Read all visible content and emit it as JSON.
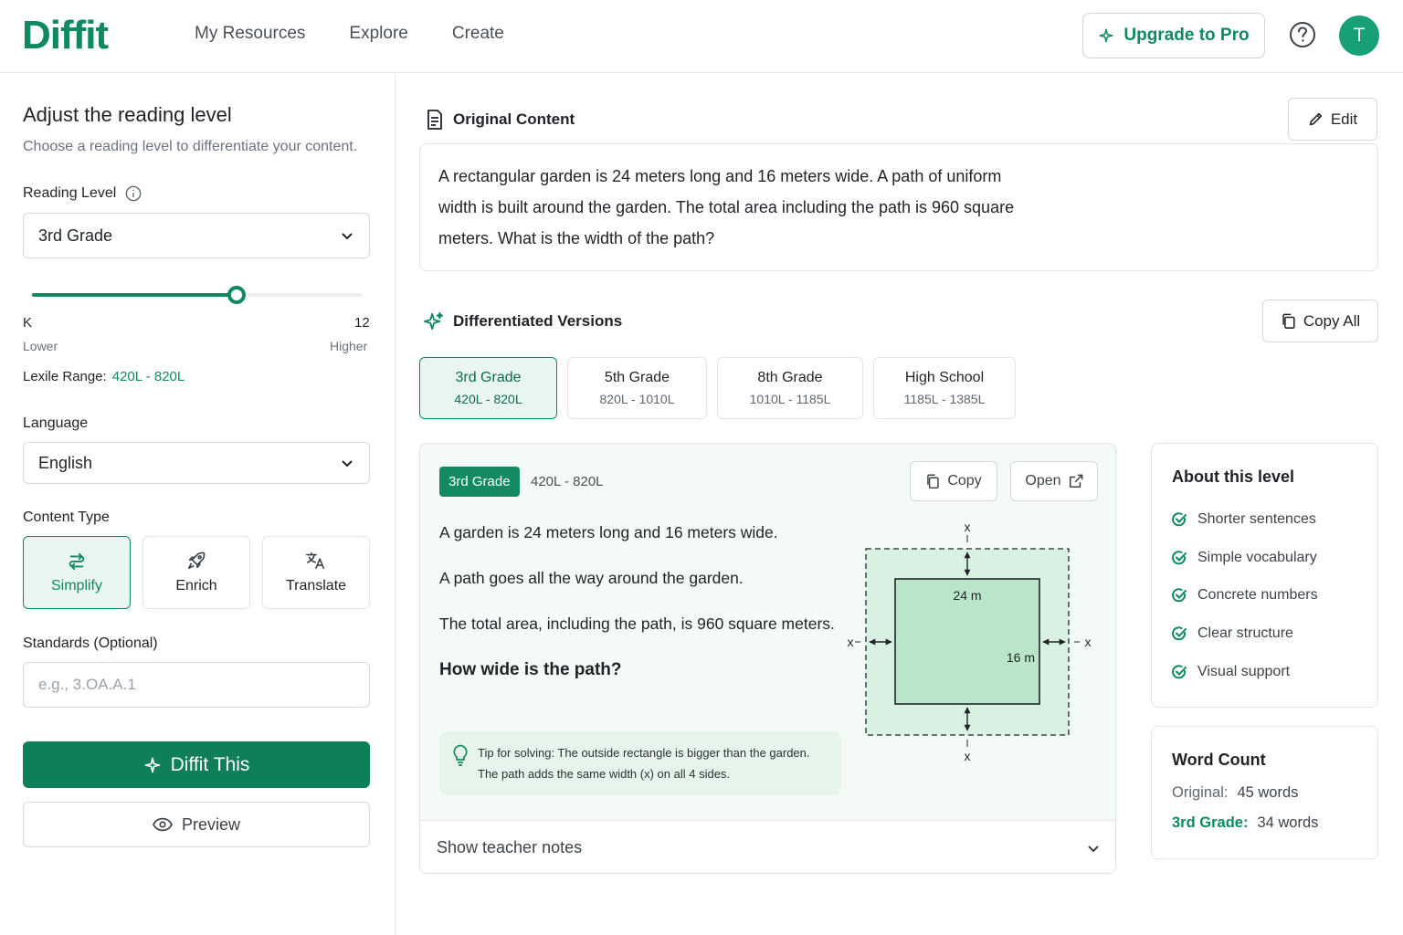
{
  "app": {
    "logo": "Diffit"
  },
  "nav": {
    "items": [
      "My Resources",
      "Explore",
      "Create"
    ]
  },
  "header": {
    "upgrade_label": "Upgrade to Pro",
    "avatar_initial": "T"
  },
  "left": {
    "title": "Adjust the reading level",
    "subtitle": "Choose a reading level to differentiate your content.",
    "reading_level_label": "Reading Level",
    "reading_level_value": "3rd Grade",
    "slider": {
      "min_label": "K",
      "max_label": "12",
      "lower_label": "Lower",
      "higher_label": "Higher",
      "level_fraction": 0.62
    },
    "lexile_label": "Lexile Range:",
    "lexile_value": "420L - 820L",
    "language_label": "Language",
    "language_value": "English",
    "content_type_label": "Content Type",
    "content_types": [
      {
        "label": "Simplify",
        "active": true
      },
      {
        "label": "Enrich",
        "active": false
      },
      {
        "label": "Translate",
        "active": false
      }
    ],
    "standards_label": "Standards (Optional)",
    "standards_placeholder": "e.g., 3.OA.A.1",
    "diffit_label": "Diffit This",
    "preview_label": "Preview"
  },
  "original": {
    "title": "Original Content",
    "edit_label": "Edit",
    "text": "A rectangular garden is 24 meters long and 16 meters wide. A path of uniform width is built around the garden. The total area including the path is 960 square meters. What is the width of the path?"
  },
  "versions": {
    "title": "Differentiated Versions",
    "copy_all_label": "Copy All",
    "tabs": [
      {
        "grade": "3rd Grade",
        "range": "420L - 820L",
        "active": true
      },
      {
        "grade": "5th Grade",
        "range": "820L - 1010L",
        "active": false
      },
      {
        "grade": "8th Grade",
        "range": "1010L - 1185L",
        "active": false
      },
      {
        "grade": "High School",
        "range": "1185L - 1385L",
        "active": false
      }
    ]
  },
  "card": {
    "badge": "3rd Grade",
    "range": "420L - 820L",
    "copy_label": "Copy",
    "open_label": "Open",
    "paragraphs": [
      "A garden is 24 meters long and 16 meters wide.",
      "A path goes all the way around the garden.",
      "The total area, including the path, is 960 square meters."
    ],
    "question": "How wide is the path?",
    "tip_line1": "Tip for solving: The outside rectangle is bigger than the garden.",
    "tip_line2": "The path adds the same width (x) on all 4 sides.",
    "diagram": {
      "length_label": "24 m",
      "width_label": "16 m",
      "x_label": "x"
    },
    "teacher_notes_label": "Show teacher notes"
  },
  "about": {
    "title": "About this level",
    "items": [
      "Shorter sentences",
      "Simple vocabulary",
      "Concrete numbers",
      "Clear structure",
      "Visual support"
    ]
  },
  "word_count": {
    "title": "Word Count",
    "original_label": "Original:",
    "original_value": "45 words",
    "grade_label": "3rd Grade:",
    "grade_value": "34 words"
  },
  "colors": {
    "brand": "#0f8a5f",
    "brand_dark": "#0f7f57",
    "active_bg": "#e9f6ef",
    "diagram_fill": "#c8ecd5"
  }
}
